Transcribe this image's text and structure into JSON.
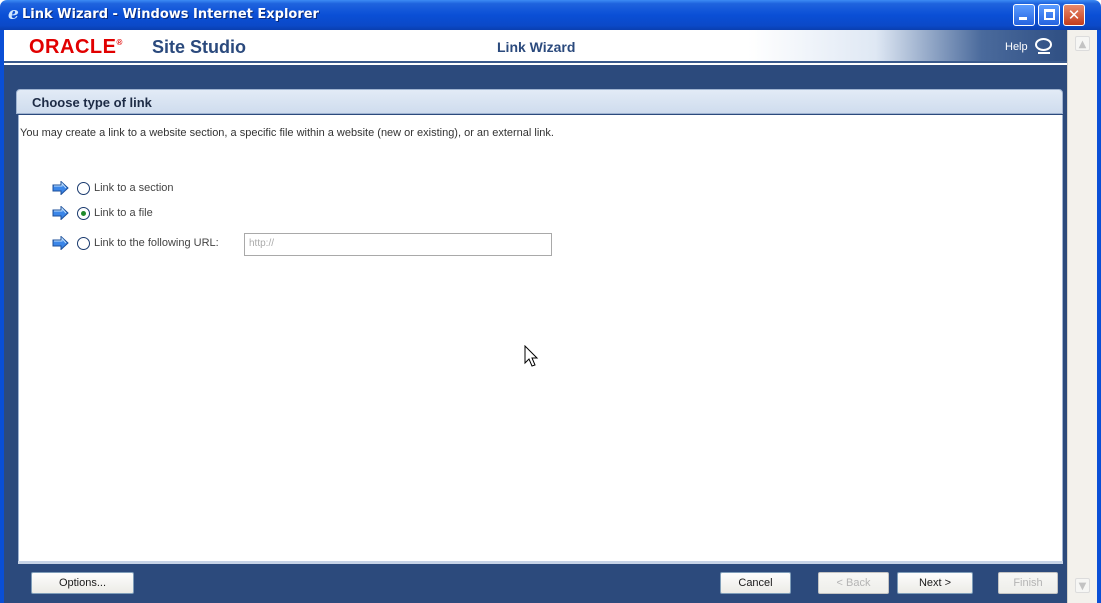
{
  "window": {
    "title": "Link Wizard - Windows Internet Explorer",
    "ie_icon": "e"
  },
  "header": {
    "logo_text": "ORACLE",
    "logo_mark": "®",
    "product": "Site Studio",
    "app_title": "Link Wizard",
    "help_label": "Help"
  },
  "section": {
    "title": "Choose type of link",
    "intro": "You may create a link to a website section, a specific file within a website (new or existing), or an external link."
  },
  "options": [
    {
      "label": "Link to a section",
      "selected": false
    },
    {
      "label": "Link to a file",
      "selected": true
    },
    {
      "label": "Link to the following URL:",
      "selected": false
    }
  ],
  "url_field": {
    "placeholder": "http://"
  },
  "footer": {
    "options_label": "Options...",
    "cancel_label": "Cancel",
    "back_label": "< Back",
    "next_label": "Next >",
    "finish_label": "Finish"
  },
  "colors": {
    "titlebar": "#0a4fd6",
    "page_background": "#2c4a7c",
    "oracle_red": "#e10000",
    "brand_blue": "#2b4a7d",
    "selected_radio": "#1f8a2a",
    "option_arrow": "#2a7de1"
  },
  "icons": {
    "option_arrow": "right-arrow-icon",
    "cursor": "mouse-pointer-icon",
    "help": "help-bubble-icon"
  }
}
